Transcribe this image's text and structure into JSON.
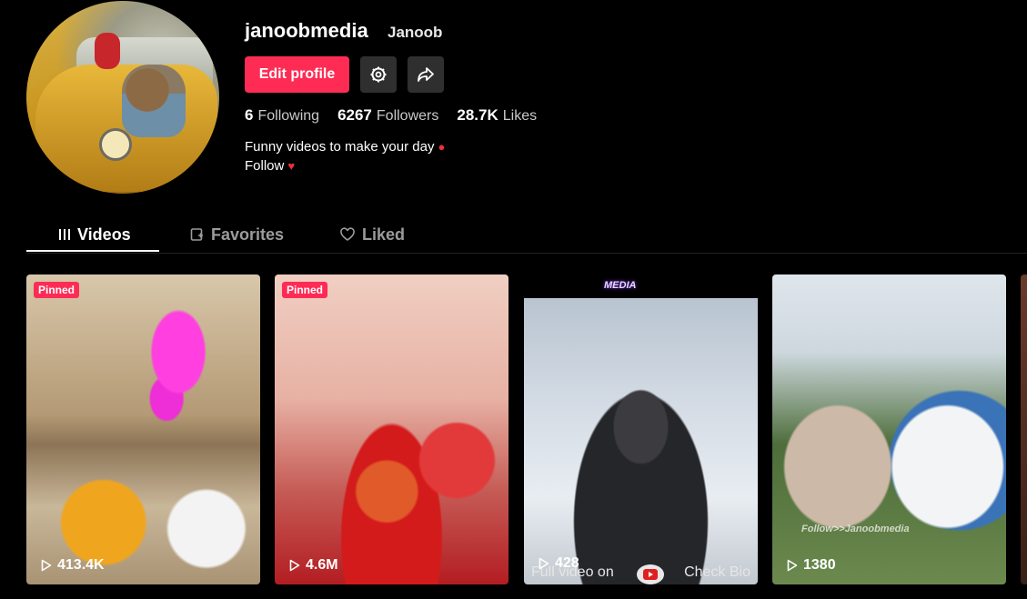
{
  "profile": {
    "username": "janoobmedia",
    "nickname": "Janoob",
    "edit_label": "Edit profile",
    "stats": [
      {
        "value": "6",
        "label": "Following"
      },
      {
        "value": "6267",
        "label": "Followers"
      },
      {
        "value": "28.7K",
        "label": "Likes"
      }
    ],
    "bio_line1": "Funny videos to make your day",
    "bio_line2": "Follow"
  },
  "tabs": [
    {
      "label": "Videos",
      "icon": "grid-icon",
      "active": true
    },
    {
      "label": "Favorites",
      "icon": "bookmark-icon",
      "active": false
    },
    {
      "label": "Liked",
      "icon": "heart-icon",
      "active": false
    }
  ],
  "videos": [
    {
      "badge": "Pinned",
      "views": "413.4K"
    },
    {
      "badge": "Pinned",
      "views": "4.6M"
    },
    {
      "views": "428",
      "overlay_logo": "MEDIA",
      "overlay_left": "Full video on",
      "overlay_right": "Check Bio"
    },
    {
      "views": "1380",
      "overlay_text": "Follow>>Janoobmedia"
    }
  ],
  "colors": {
    "accent": "#fe2c55",
    "background": "#000000"
  }
}
